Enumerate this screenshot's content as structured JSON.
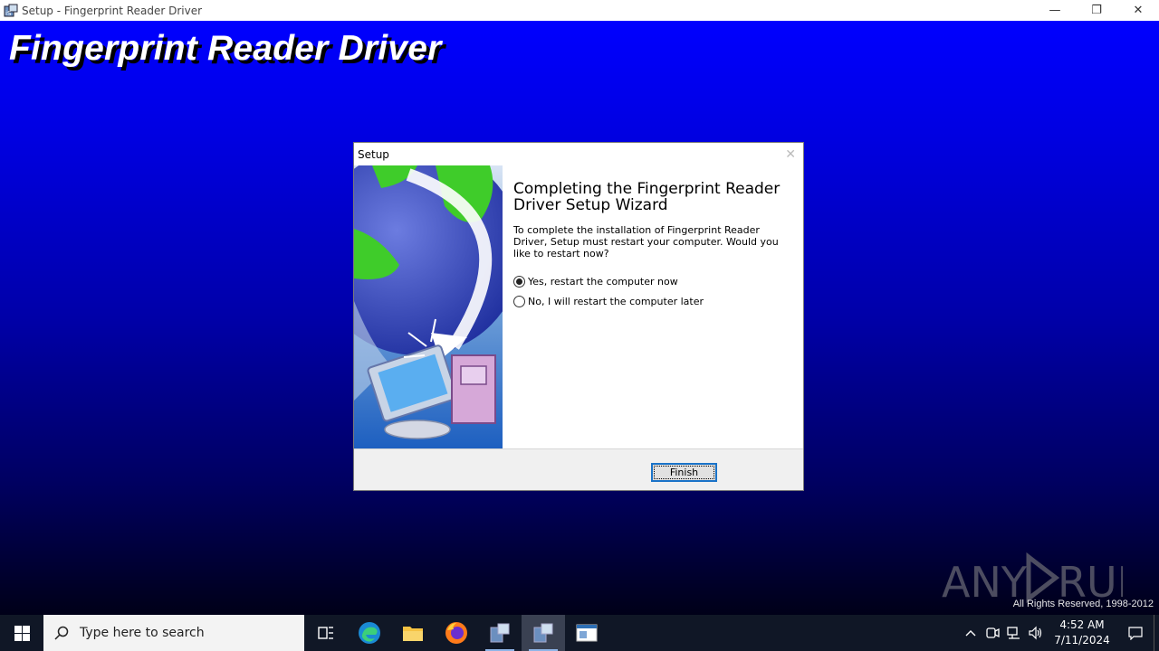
{
  "window": {
    "title": "Setup - Fingerprint Reader Driver",
    "minimize": "—",
    "restore": "❐",
    "close": "✕"
  },
  "background": {
    "product_title": "Fingerprint Reader Driver",
    "copyright": "All Rights Reserved, 1998-2012",
    "watermark": "ANY RUN"
  },
  "dialog": {
    "title": "Setup",
    "close": "✕",
    "heading": "Completing the Fingerprint Reader Driver Setup Wizard",
    "description": "To complete the installation of Fingerprint Reader Driver, Setup must restart your computer. Would you like to restart now?",
    "options": [
      {
        "label": "Yes, restart the computer now",
        "checked": true
      },
      {
        "label": "No, I will restart the computer later",
        "checked": false
      }
    ],
    "finish_label": "Finish"
  },
  "taskbar": {
    "search_placeholder": "Type here to search",
    "apps": [
      "task-view",
      "edge",
      "file-explorer",
      "firefox",
      "installer",
      "setup-active",
      "app-window"
    ],
    "clock_time": "4:52 AM",
    "clock_date": "7/11/2024"
  },
  "colors": {
    "background_top": "#0000ff",
    "background_bottom": "#000018",
    "taskbar": "#101726",
    "button_border": "#1a73c8"
  }
}
